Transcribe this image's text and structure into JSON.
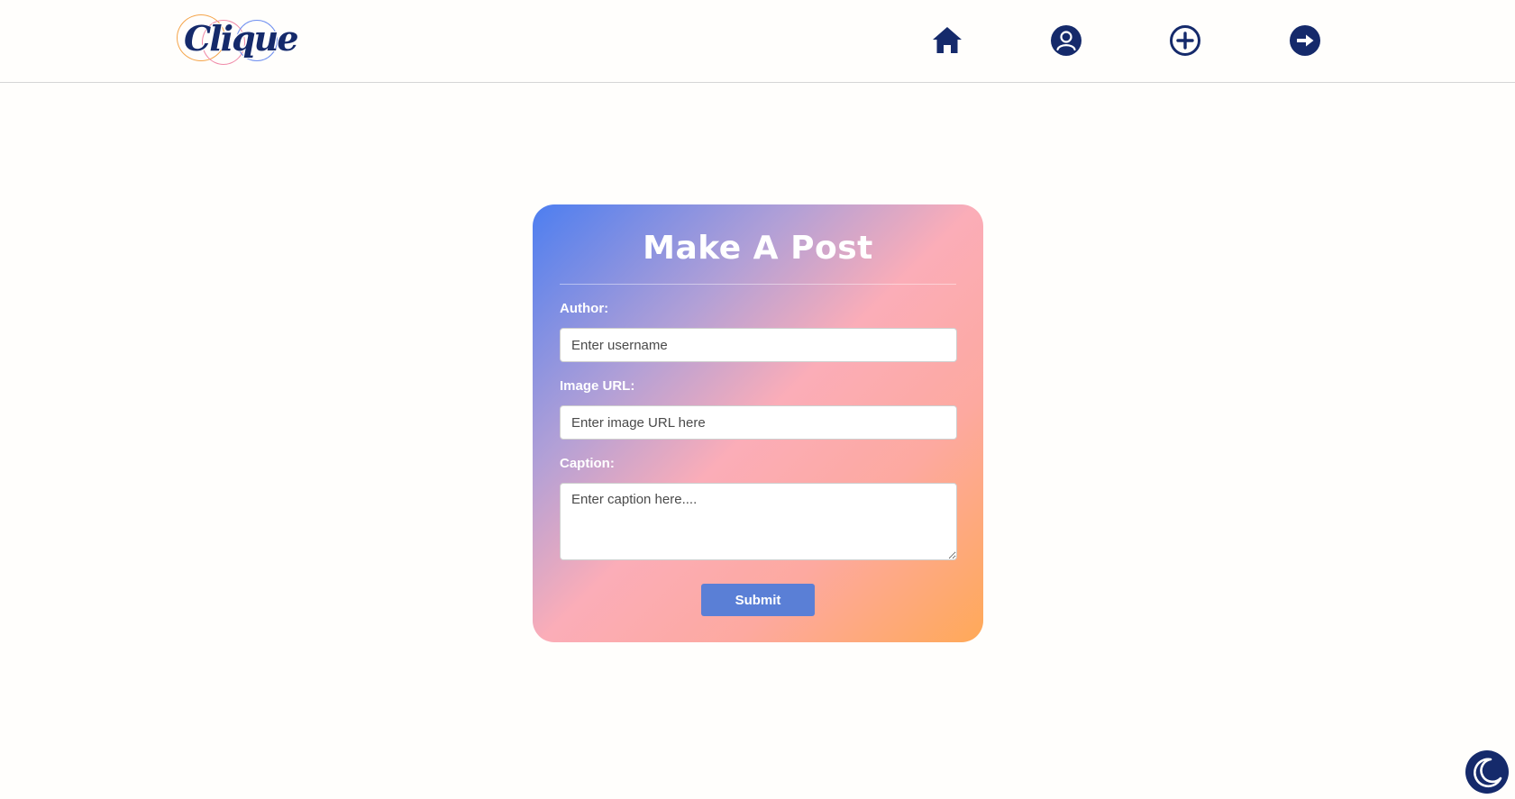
{
  "app": {
    "logo_text": "Clique"
  },
  "nav": {
    "items": [
      {
        "name": "home-icon"
      },
      {
        "name": "profile-icon"
      },
      {
        "name": "add-post-icon"
      },
      {
        "name": "logout-icon"
      }
    ]
  },
  "form": {
    "title": "Make A Post",
    "author_label": "Author:",
    "author_placeholder": "Enter username",
    "author_value": "",
    "image_label": "Image URL:",
    "image_placeholder": "Enter image URL here",
    "image_value": "",
    "caption_label": "Caption:",
    "caption_placeholder": "Enter caption here....",
    "caption_value": "",
    "submit_label": "Submit"
  },
  "theme_toggle": {
    "icon": "moon-icon"
  },
  "colors": {
    "brand_navy": "#152a6b",
    "gradient_start": "#4d7ef0",
    "gradient_mid": "#fbadb8",
    "gradient_end": "#ffa958",
    "submit_button": "#5a7fd6"
  }
}
